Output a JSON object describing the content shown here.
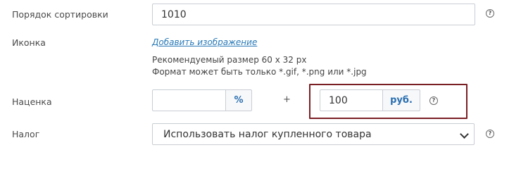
{
  "sort_order": {
    "label": "Порядок сортировки",
    "value": "1010"
  },
  "icon": {
    "label": "Иконка",
    "add_image_link": "Добавить изображение",
    "hint_size": "Рекомендуемый размер 60 x 32 px",
    "hint_format": "Формат может быть только *.gif, *.png или *.jpg"
  },
  "markup": {
    "label": "Наценка",
    "percent_value": "",
    "percent_unit": "%",
    "plus_sign": "+",
    "fixed_value": "100",
    "fixed_unit": "руб."
  },
  "tax": {
    "label": "Налог",
    "selected": "Использовать налог купленного товара"
  },
  "help_glyph": "?",
  "colors": {
    "accent": "#2a6fb0",
    "link": "#2a7ab8",
    "highlight_border": "#7a1f24"
  }
}
